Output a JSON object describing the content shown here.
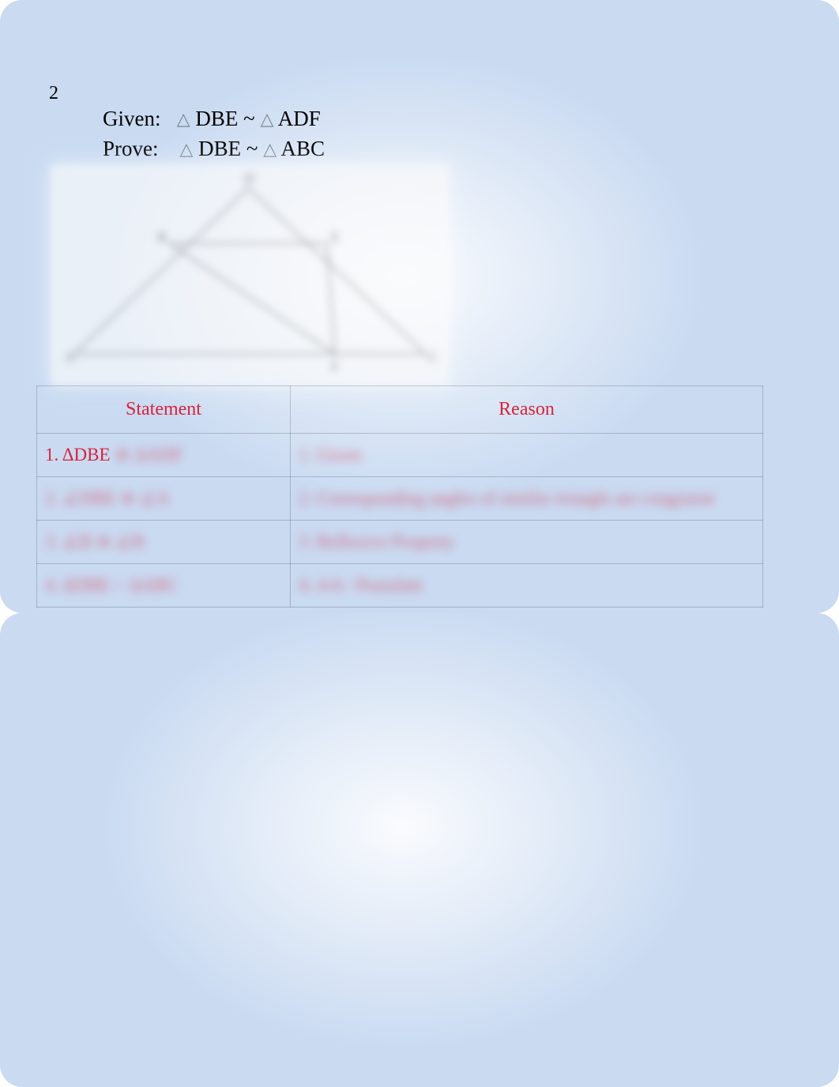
{
  "page_number": "2",
  "given_label": "Given:",
  "given_value_1": "DBE ~",
  "given_value_2": "ADF",
  "prove_label": "Prove:",
  "prove_value_1": "DBE ~",
  "prove_value_2": "ABC",
  "table": {
    "headers": {
      "statement": "Statement",
      "reason": "Reason"
    },
    "rows": [
      {
        "statement_prefix": "1. ΔDBE",
        "statement_rest": "≅ ΔADF",
        "reason": "1. Given"
      },
      {
        "statement_prefix": "",
        "statement_rest": "2. ∠DBE ≅ ∠A",
        "reason": "2. Corresponding angles of similar triangle are congruent"
      },
      {
        "statement_prefix": "",
        "statement_rest": "3. ∠B ≅ ∠B",
        "reason": "3. Reflexive Property"
      },
      {
        "statement_prefix": "",
        "statement_rest": "4. ΔDBE ~ ΔABC",
        "reason": "4. AA~ Postulate"
      }
    ]
  }
}
